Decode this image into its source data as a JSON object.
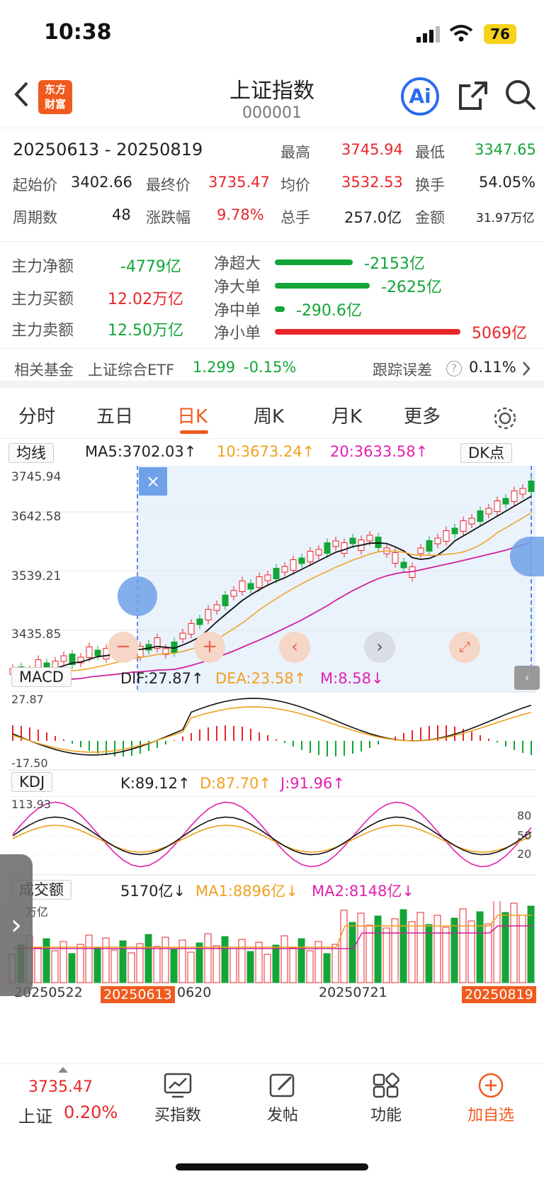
{
  "status": {
    "time": "10:38",
    "battery": "76"
  },
  "header": {
    "title": "上证指数",
    "code": "000001",
    "logo_line1": "东方",
    "logo_line2": "财富",
    "ai": "Ai"
  },
  "stats": {
    "range": "20250613  -  20250819",
    "high_label": "最高",
    "high": "3745.94",
    "low_label": "最低",
    "low": "3347.65",
    "open_label": "起始价",
    "open": "3402.66",
    "close_label": "最终价",
    "close": "3735.47",
    "avg_label": "均价",
    "avg": "3532.53",
    "turnover_label": "换手",
    "turnover": "54.05%",
    "period_label": "周期数",
    "period": "48",
    "chg_label": "涨跌幅",
    "chg": "9.78%",
    "vol_label": "总手",
    "vol": "257.0亿",
    "amt_label": "金额",
    "amt": "31.97万亿"
  },
  "flow": {
    "net_label": "主力净额",
    "net": "-4779亿",
    "buy_label": "主力买额",
    "buy": "12.02万亿",
    "sell_label": "主力卖额",
    "sell": "12.50万亿",
    "items": [
      {
        "label": "净超大",
        "value": "-2153亿"
      },
      {
        "label": "净大单",
        "value": "-2625亿"
      },
      {
        "label": "净中单",
        "value": "-290.6亿"
      },
      {
        "label": "净小单",
        "value": "5069亿"
      }
    ]
  },
  "fund": {
    "label": "相关基金",
    "name": "上证综合ETF",
    "price": "1.299",
    "chg": "-0.15%",
    "err_label": "跟踪误差",
    "err": "0.11%"
  },
  "tabs": [
    "分时",
    "五日",
    "日K",
    "周K",
    "月K",
    "更多"
  ],
  "kline": {
    "ma_select": "均线",
    "ma5": "MA5:3702.03↑",
    "ma10": "10:3673.24↑",
    "ma20": "20:3633.58↑",
    "dk": "DK点",
    "y_ticks": [
      "3745.94",
      "3642.58",
      "3539.21",
      "3435.85"
    ],
    "macd_select": "MACD",
    "dif": "DIF:27.87↑",
    "dea": "DEA:23.58↑",
    "m": "M:8.58↓",
    "macd_top": "27.87",
    "macd_bottom": "-17.50",
    "kdj_select": "KDJ",
    "k": "K:89.12↑",
    "d": "D:87.70↑",
    "j": "J:91.96↑",
    "kdj_top": "113.93",
    "kdj_levels": [
      "80",
      "50",
      "20"
    ],
    "vol_select": "成交额",
    "vol": "5170亿↓",
    "vma1": "MA1:8896亿↓",
    "vma2": "MA2:8148亿↓",
    "vol_unit": "万亿",
    "dates": [
      "20250522",
      "20250613",
      "0620",
      "20250721",
      "20250819"
    ]
  },
  "bottom": {
    "price": "3735.47",
    "name": "上证",
    "chg": "0.20%",
    "items": [
      "买指数",
      "发帖",
      "功能",
      "加自选"
    ]
  }
}
